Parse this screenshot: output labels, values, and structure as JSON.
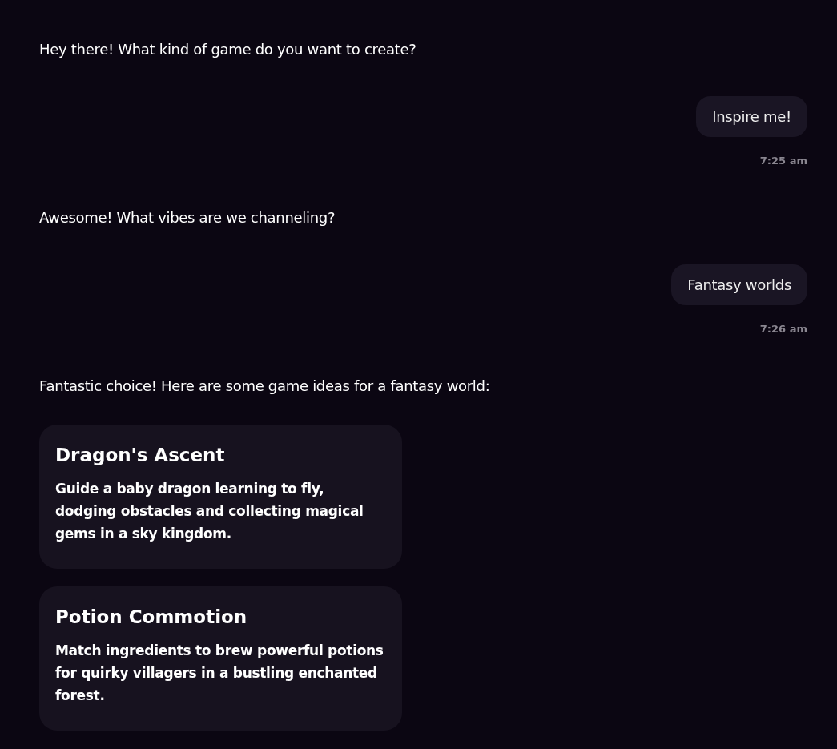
{
  "messages": [
    {
      "kind": "assistant",
      "text": "Hey there! What kind of game do you want to create?"
    },
    {
      "kind": "user",
      "text": "Inspire me!",
      "time": "7:25 am"
    },
    {
      "kind": "assistant",
      "text": "Awesome! What vibes are we channeling?"
    },
    {
      "kind": "user",
      "text": "Fantasy worlds",
      "time": "7:26 am"
    },
    {
      "kind": "assistant",
      "text": "Fantastic choice! Here are some game ideas for a fantasy world:",
      "cards": [
        {
          "title": "Dragon's Ascent",
          "description": "Guide a baby dragon learning to fly, dodging obstacles and collecting magical gems in a sky kingdom."
        },
        {
          "title": "Potion Commotion",
          "description": "Match ingredients to brew powerful potions for quirky villagers in a bustling enchanted forest."
        }
      ]
    }
  ]
}
